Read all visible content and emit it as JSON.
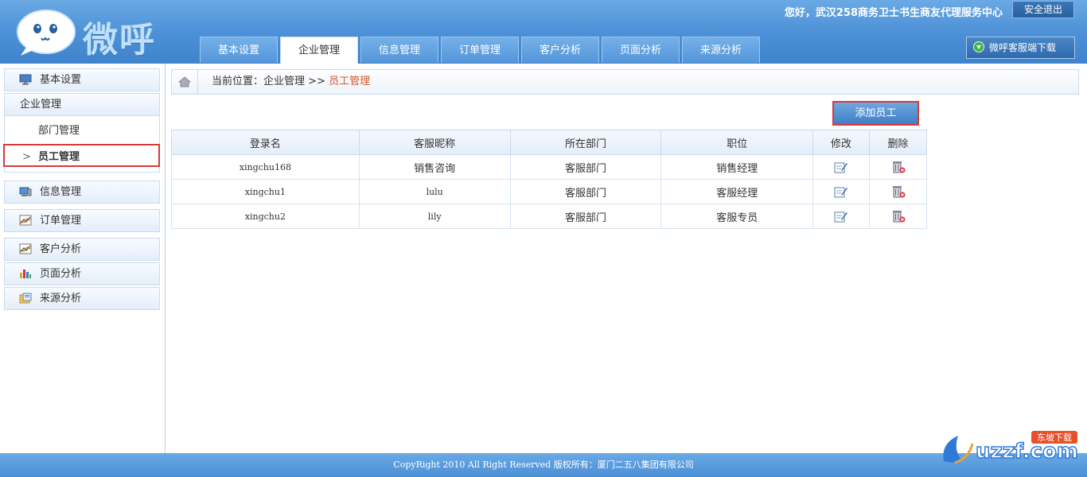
{
  "header": {
    "logo_text": "微呼",
    "greeting": "您好，武汉258商务卫士书生商友代理服务中心",
    "logout_label": "安全退出",
    "download_label": "微呼客服端下载",
    "tabs": [
      {
        "label": "基本设置",
        "active": false
      },
      {
        "label": "企业管理",
        "active": true
      },
      {
        "label": "信息管理",
        "active": false
      },
      {
        "label": "订单管理",
        "active": false
      },
      {
        "label": "客户分析",
        "active": false
      },
      {
        "label": "页面分析",
        "active": false
      },
      {
        "label": "来源分析",
        "active": false
      }
    ]
  },
  "sidebar": {
    "basic": "基本设置",
    "enterprise": "企业管理",
    "sub": [
      "部门管理",
      "员工管理"
    ],
    "info": "信息管理",
    "order": "订单管理",
    "customer": "客户分析",
    "page": "页面分析",
    "source": "来源分析"
  },
  "breadcrumb": {
    "prefix": "当前位置：企业管理 >> ",
    "current": "员工管理"
  },
  "add_button": "添加员工",
  "table": {
    "headers": [
      "登录名",
      "客服昵称",
      "所在部门",
      "职位",
      "修改",
      "删除"
    ],
    "rows": [
      {
        "login": "xingchu168",
        "nickname": "销售咨询",
        "dept": "客服部门",
        "position": "销售经理"
      },
      {
        "login": "xingchu1",
        "nickname": "lulu",
        "dept": "客服部门",
        "position": "客服经理"
      },
      {
        "login": "xingchu2",
        "nickname": "lily",
        "dept": "客服部门",
        "position": "客服专员"
      }
    ]
  },
  "footer": "CopyRight 2010 All Right Reserved 版权所有：厦门二五八集团有限公司",
  "watermark": {
    "brand": "uzzf.com",
    "tag": "东坡下载"
  },
  "colors": {
    "header_blue": "#4b8fd6",
    "highlight_red": "#d9393b",
    "breadcrumb_current": "#d4572c"
  }
}
